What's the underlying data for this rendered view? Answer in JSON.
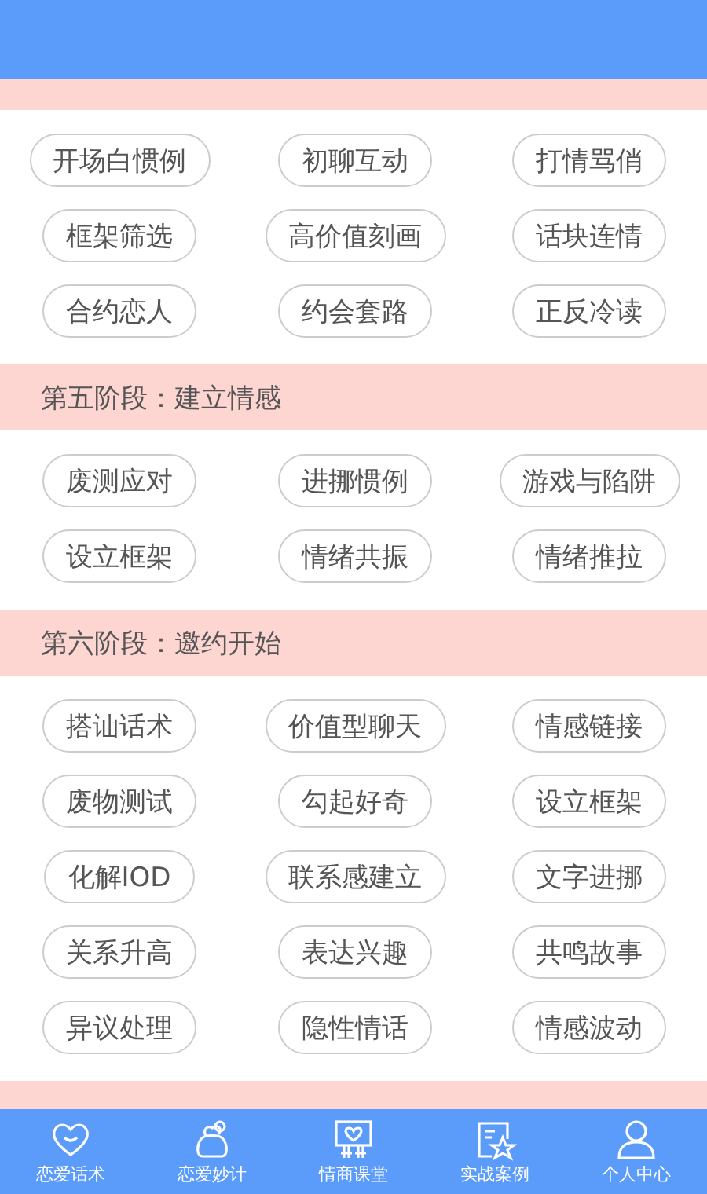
{
  "sections": [
    {
      "kind": "section",
      "items": [
        "开场白惯例",
        "初聊互动",
        "打情骂俏",
        "框架筛选",
        "高价值刻画",
        "话块连情",
        "合约恋人",
        "约会套路",
        "正反冷读"
      ]
    },
    {
      "kind": "section",
      "title": "第五阶段：建立情感",
      "items": [
        "废测应对",
        "进挪惯例",
        "游戏与陷阱",
        "设立框架",
        "情绪共振",
        "情绪推拉"
      ]
    },
    {
      "kind": "section",
      "title": "第六阶段：邀约开始",
      "items": [
        "搭讪话术",
        "价值型聊天",
        "情感链接",
        "废物测试",
        "勾起好奇",
        "设立框架",
        "化解IOD",
        "联系感建立",
        "文字进挪",
        "关系升高",
        "表达兴趣",
        "共鸣故事",
        "异议处理",
        "隐性情话",
        "情感波动"
      ]
    },
    {
      "kind": "band"
    }
  ],
  "tabs": [
    {
      "label": "恋爱话术",
      "kind": "heart"
    },
    {
      "label": "恋爱妙计",
      "kind": "bag"
    },
    {
      "label": "情商课堂",
      "kind": "board"
    },
    {
      "label": "实战案例",
      "kind": "star"
    },
    {
      "label": "个人中心",
      "kind": "person"
    }
  ]
}
